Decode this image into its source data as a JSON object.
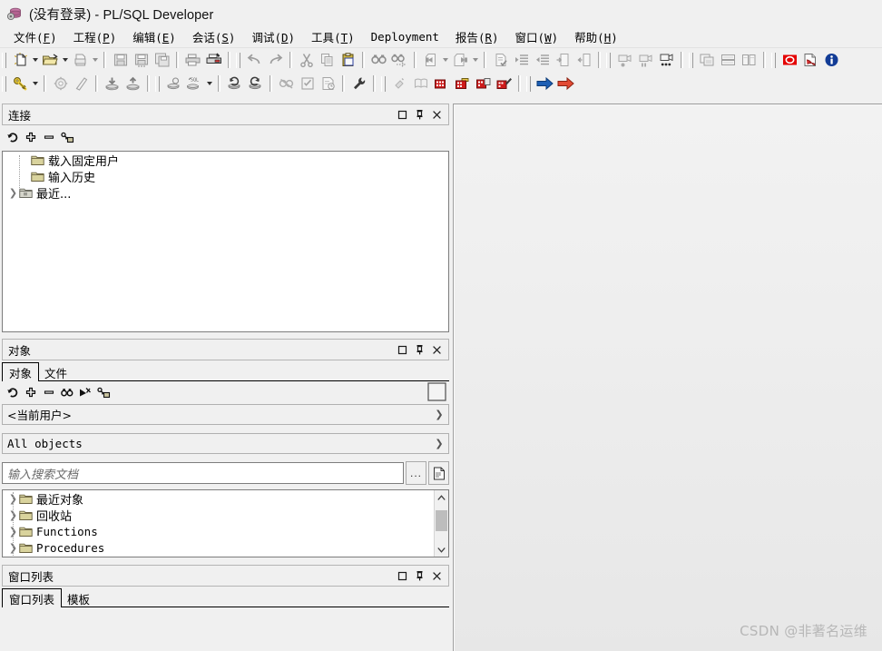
{
  "window": {
    "title": "(没有登录) - PL/SQL Developer",
    "app_icon": "database-icon"
  },
  "menubar": {
    "items": [
      {
        "label": "文件",
        "accel": "F"
      },
      {
        "label": "工程",
        "accel": "P"
      },
      {
        "label": "编辑",
        "accel": "E"
      },
      {
        "label": "会话",
        "accel": "S"
      },
      {
        "label": "调试",
        "accel": "D"
      },
      {
        "label": "工具",
        "accel": "T"
      },
      {
        "label": "Deployment",
        "accel": ""
      },
      {
        "label": "报告",
        "accel": "R"
      },
      {
        "label": "窗口",
        "accel": "W"
      },
      {
        "label": "帮助",
        "accel": "H"
      }
    ]
  },
  "toolbar_row1": {
    "icons": [
      "new-document-icon",
      "open-folder-icon",
      "print-preview-icon",
      "save-icon",
      "save-all-icon",
      "save-as-icon",
      "print-icon",
      "print-setup-icon",
      "undo-icon",
      "redo-icon",
      "cut-icon",
      "copy-icon",
      "paste-icon",
      "find-icon",
      "find-next-icon",
      "previous-page-icon",
      "next-page-icon",
      "execute-report-icon",
      "indent-icon",
      "outdent-icon",
      "comment-icon",
      "uncomment-icon",
      "record-macro-icon",
      "stop-macro-icon",
      "play-macro-icon",
      "macro-list-icon",
      "cascade-windows-icon",
      "tile-horizontal-icon",
      "tile-vertical-icon",
      "stop-icon",
      "pdf-export-icon",
      "about-info-icon"
    ]
  },
  "toolbar_row2": {
    "icons": [
      "login-key-icon",
      "session-options-icon",
      "clear-session-icon",
      "import-icon",
      "export-icon",
      "commit-icon",
      "sql-window-icon",
      "rollback-icon",
      "reload-icon",
      "break-icon",
      "test-script-icon",
      "explain-plan-icon",
      "wrench-tools-icon",
      "step-icon",
      "reference-icon",
      "debug-run-icon",
      "debug-step-over-icon",
      "debug-step-into-icon",
      "debug-step-out-icon",
      "next-blue-arrow-icon",
      "next-red-arrow-icon"
    ]
  },
  "connections_panel": {
    "title": "连接",
    "buttons": [
      "maximize-icon",
      "pin-icon",
      "close-icon"
    ],
    "toolbar": [
      "refresh-icon",
      "add-icon",
      "remove-icon",
      "logon-key-icon"
    ],
    "tree": [
      {
        "label": "载入固定用户",
        "icon": "folder-icon",
        "expandable": false,
        "mono": false
      },
      {
        "label": "输入历史",
        "icon": "folder-icon",
        "expandable": false,
        "mono": false
      },
      {
        "label": "最近...",
        "icon": "folder-grey-icon",
        "expandable": true,
        "mono": false
      }
    ]
  },
  "objects_panel": {
    "title": "对象",
    "buttons": [
      "maximize-icon",
      "pin-icon",
      "close-icon"
    ],
    "tabs": [
      {
        "label": "对象",
        "active": true
      },
      {
        "label": "文件",
        "active": false
      }
    ],
    "toolbar": [
      "refresh-icon",
      "add-icon",
      "remove-icon",
      "find-icon",
      "filter-icon",
      "logon-key-icon"
    ],
    "toolbar_right_box": "empty-preview-box",
    "user_select": {
      "value": "<当前用户>",
      "icon": "chevron-down-icon"
    },
    "filter_select": {
      "value": "All objects",
      "icon": "chevron-down-icon"
    },
    "search": {
      "placeholder": "输入搜索文档",
      "value": "",
      "ellipsis_button": "...",
      "doc_button": "document-search-icon"
    },
    "tree": [
      {
        "label": "最近对象",
        "icon": "folder-icon",
        "expandable": true,
        "mono": false
      },
      {
        "label": "回收站",
        "icon": "folder-icon",
        "expandable": true,
        "mono": false
      },
      {
        "label": "Functions",
        "icon": "folder-icon",
        "expandable": true,
        "mono": true
      },
      {
        "label": "Procedures",
        "icon": "folder-icon",
        "expandable": true,
        "mono": true
      }
    ],
    "scrollbar": {
      "up": "▲",
      "down": "▼"
    }
  },
  "window_list_panel": {
    "title": "窗口列表",
    "buttons": [
      "maximize-icon",
      "pin-icon",
      "close-icon"
    ],
    "tabs": [
      {
        "label": "窗口列表",
        "active": true
      },
      {
        "label": "模板",
        "active": false
      }
    ]
  },
  "workspace": {
    "watermark": "CSDN @非著名运维"
  },
  "colors": {
    "face": "#f0f0f0",
    "folder": "#d8d3a0",
    "accent_blue": "#1d5fb4",
    "accent_red": "#d01b1b",
    "watermark": "#b7b7b7"
  }
}
